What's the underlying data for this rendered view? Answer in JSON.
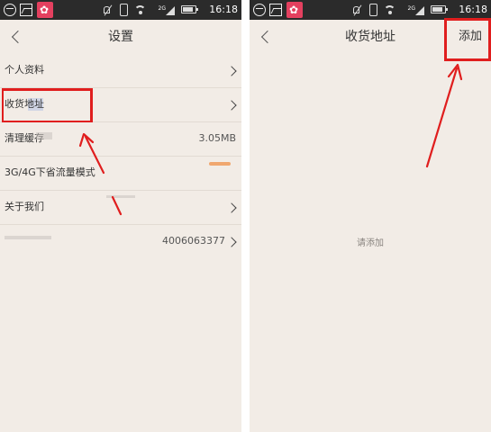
{
  "status_bar": {
    "time": "16:18",
    "network": "2G",
    "icons": [
      "face-icon",
      "image-icon",
      "app-badge-icon",
      "mute-icon",
      "vibrate-icon",
      "wifi-icon",
      "signal-icon",
      "battery-icon"
    ]
  },
  "settings_screen": {
    "title": "设置",
    "back_icon": "chevron-left-icon",
    "items": [
      {
        "label": "个人资料",
        "value": "",
        "has_chevron": true
      },
      {
        "label": "收货地址",
        "value": "",
        "has_chevron": true
      },
      {
        "label": "清理缓存",
        "value": "3.05MB",
        "has_chevron": false
      },
      {
        "label": "3G/4G下省流量模式",
        "value": "",
        "has_chevron": false
      },
      {
        "label": "关于我们",
        "value": "",
        "has_chevron": true
      },
      {
        "label": "",
        "value": "4006063377",
        "has_chevron": true
      }
    ]
  },
  "address_screen": {
    "title": "收货地址",
    "back_icon": "chevron-left-icon",
    "add_label": "添加",
    "empty_text": "请添加"
  },
  "colors": {
    "background": "#f2ece6",
    "status_bar": "#2b2b2b",
    "annotation": "#e01e1e",
    "toggle_accent": "#f08a3c"
  }
}
